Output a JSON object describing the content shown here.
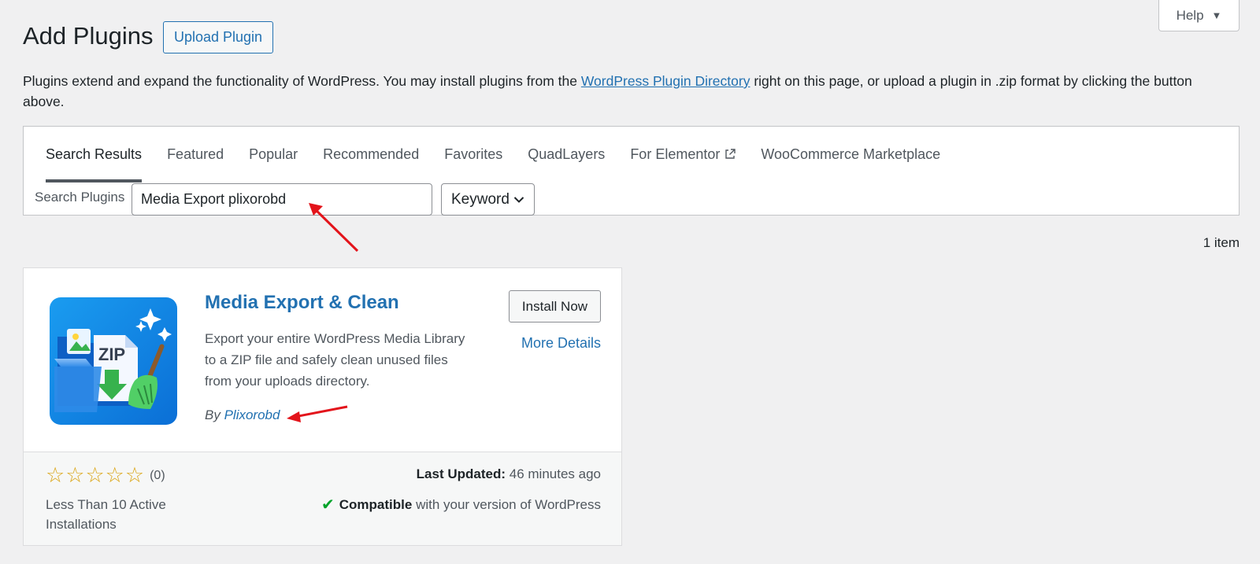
{
  "help": {
    "label": "Help",
    "caret": "▼"
  },
  "header": {
    "title": "Add Plugins",
    "upload_label": "Upload Plugin"
  },
  "intro": {
    "before": "Plugins extend and expand the functionality of WordPress. You may install plugins from the ",
    "link": "WordPress Plugin Directory",
    "after": " right on this page, or upload a plugin in .zip format by clicking the button above."
  },
  "tabs": [
    {
      "label": "Search Results",
      "active": true
    },
    {
      "label": "Featured"
    },
    {
      "label": "Popular"
    },
    {
      "label": "Recommended"
    },
    {
      "label": "Favorites"
    },
    {
      "label": "QuadLayers"
    },
    {
      "label": "For Elementor",
      "external": true
    },
    {
      "label": "WooCommerce Marketplace"
    }
  ],
  "search": {
    "label": "Search Plugins",
    "value": "Media Export plixorobd",
    "type": "Keyword"
  },
  "results": {
    "count": "1 item"
  },
  "plugin": {
    "name": "Media Export & Clean",
    "description": "Export your entire WordPress Media Library to a ZIP file and safely clean unused files from your uploads directory.",
    "by": "By",
    "author": "Plixorobd",
    "install_label": "Install Now",
    "details_label": "More Details",
    "icon_text": "ZIP",
    "rating_stars": 0,
    "rating_count": "(0)",
    "installs": "Less Than 10 Active Installations",
    "last_updated_label": "Last Updated:",
    "last_updated_value": "46 minutes ago",
    "compatible_label": "Compatible",
    "compatible_rest": "with your version of WordPress"
  },
  "colors": {
    "link": "#2271b1",
    "star": "#dba617",
    "check": "#00a32a",
    "annotation": "#e3141b"
  }
}
